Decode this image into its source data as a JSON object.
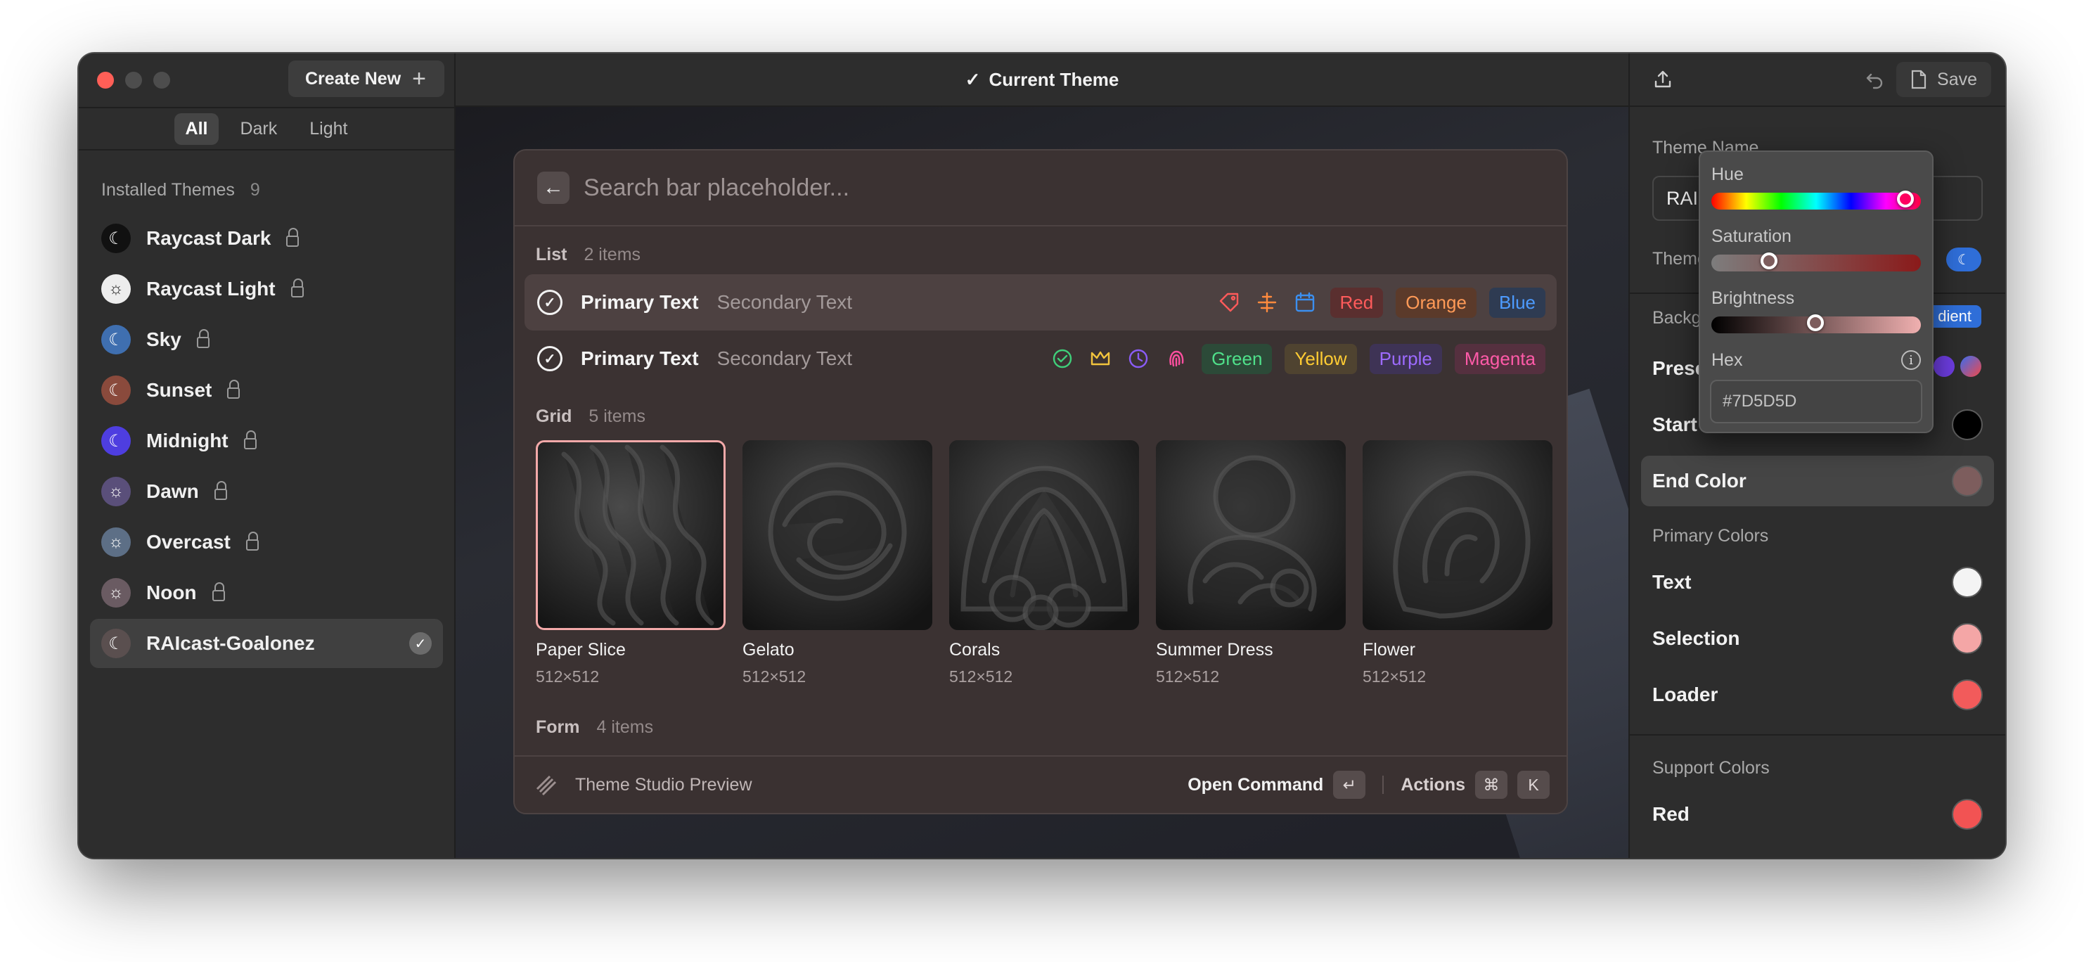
{
  "sidebar": {
    "create_new_label": "Create New",
    "segments": [
      "All",
      "Dark",
      "Light"
    ],
    "active_segment": "All",
    "section_title": "Installed Themes",
    "section_count": "9",
    "themes": [
      {
        "name": "Raycast Dark",
        "icon": "moon-icon",
        "color": "#111111",
        "locked": true
      },
      {
        "name": "Raycast Light",
        "icon": "sun-icon",
        "color": "#ededed",
        "locked": true
      },
      {
        "name": "Sky",
        "icon": "moon-icon",
        "color": "#3f6fb0",
        "locked": true
      },
      {
        "name": "Sunset",
        "icon": "moon-icon",
        "color": "#8a4a3c",
        "locked": true
      },
      {
        "name": "Midnight",
        "icon": "moon-icon",
        "color": "#4e3ee0",
        "locked": true
      },
      {
        "name": "Dawn",
        "icon": "sun-icon",
        "color": "#5a4f7a",
        "locked": true
      },
      {
        "name": "Overcast",
        "icon": "sun-icon",
        "color": "#5d6f86",
        "locked": true
      },
      {
        "name": "Noon",
        "icon": "sun-icon",
        "color": "#6a5b62",
        "locked": true
      },
      {
        "name": "RAIcast-Goalonez",
        "icon": "moon-icon",
        "color": "#5a4f4f",
        "locked": false,
        "selected": true
      }
    ]
  },
  "center": {
    "title": "Current Theme",
    "search_placeholder": "Search bar placeholder...",
    "list_title": "List",
    "list_count": "2 items",
    "list_rows": [
      {
        "primary": "Primary Text",
        "secondary": "Secondary Text",
        "icons": [
          {
            "name": "tag-icon",
            "color": "#ff5a5a"
          },
          {
            "name": "plane-icon",
            "color": "#ff8a3d"
          },
          {
            "name": "calendar-icon",
            "color": "#3b8ff0"
          }
        ],
        "tags": [
          {
            "label": "Red",
            "color": "#ff5b5b",
            "bg": "#5a2f2f"
          },
          {
            "label": "Orange",
            "color": "#ff9a57",
            "bg": "#5b3a2a"
          },
          {
            "label": "Blue",
            "color": "#4d9bff",
            "bg": "#2e3b52"
          }
        ]
      },
      {
        "primary": "Primary Text",
        "secondary": "Secondary Text",
        "icons": [
          {
            "name": "check-circle-icon",
            "color": "#3fcf7a"
          },
          {
            "name": "crown-icon",
            "color": "#f2c43d"
          },
          {
            "name": "clock-icon",
            "color": "#8a5cf5"
          },
          {
            "name": "fingerprint-icon",
            "color": "#ff4fa0"
          }
        ],
        "tags": [
          {
            "label": "Green",
            "color": "#4fe08a",
            "bg": "#2c4a38"
          },
          {
            "label": "Yellow",
            "color": "#ffcc33",
            "bg": "#4f4330"
          },
          {
            "label": "Purple",
            "color": "#9d6bff",
            "bg": "#3e3355"
          },
          {
            "label": "Magenta",
            "color": "#ff5aa8",
            "bg": "#55303f"
          }
        ]
      }
    ],
    "grid_title": "Grid",
    "grid_count": "5 items",
    "grid_items": [
      {
        "title": "Paper Slice",
        "size": "512×512"
      },
      {
        "title": "Gelato",
        "size": "512×512"
      },
      {
        "title": "Corals",
        "size": "512×512"
      },
      {
        "title": "Summer Dress",
        "size": "512×512"
      },
      {
        "title": "Flower",
        "size": "512×512"
      }
    ],
    "form_title": "Form",
    "form_count": "4 items",
    "footer": {
      "preview_label": "Theme Studio Preview",
      "open_command": "Open Command",
      "enter_key": "↵",
      "actions": "Actions",
      "cmd_key": "⌘",
      "k_key": "K"
    }
  },
  "right": {
    "save_label": "Save",
    "theme_name_label": "Theme Name",
    "theme_name_value": "RAIc",
    "theme_label": "Theme",
    "background_label": "Backg",
    "gradient_label": "dient",
    "presets_label": "Prese",
    "start_label": "Start",
    "start_color": "#000000",
    "end_color_label": "End Color",
    "end_color": "#7D5D5D",
    "primary_colors_label": "Primary Colors",
    "primary": [
      {
        "label": "Text",
        "color": "#F4F4F4"
      },
      {
        "label": "Selection",
        "color": "#F4A6A6"
      },
      {
        "label": "Loader",
        "color": "#F25B5B"
      }
    ],
    "support_colors_label": "Support Colors",
    "support": [
      {
        "label": "Red",
        "color": "#F25353"
      }
    ]
  },
  "popover": {
    "hue_label": "Hue",
    "hue_value": 0.95,
    "saturation_label": "Saturation",
    "saturation_value": 0.25,
    "brightness_label": "Brightness",
    "brightness_value": 0.49,
    "hex_label": "Hex",
    "hex_value": "#7D5D5D"
  }
}
